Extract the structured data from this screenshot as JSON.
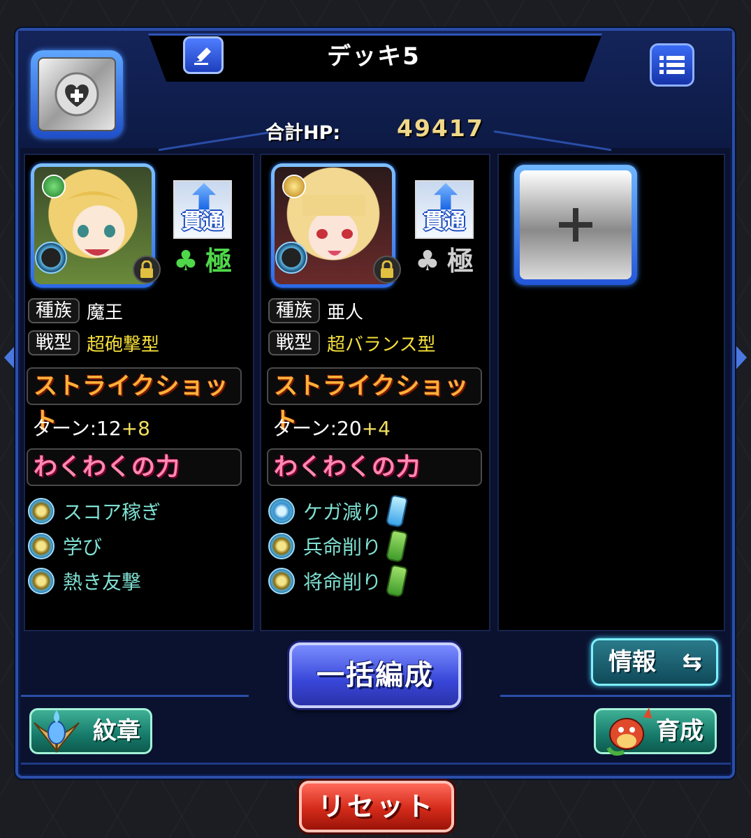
{
  "deck": {
    "title": "デッキ5",
    "hp_label": "合計HP:",
    "hp_value": "49417"
  },
  "characters": [
    {
      "ability": "貫通",
      "rank_label": "極",
      "rank_color": "#4fd84a",
      "element_color": "#3aa84a",
      "species_key": "種族",
      "species": "魔王",
      "type_key": "戦型",
      "type": "超砲撃型",
      "strike_shot_label": "ストライクショット",
      "turn_label": "ターン:12",
      "turn_plus": "+8",
      "waku_label": "わくわくの力",
      "waku_items": [
        {
          "text": "スコア稼ぎ"
        },
        {
          "text": "学び"
        },
        {
          "text": "熱き友撃"
        }
      ]
    },
    {
      "ability": "貫通",
      "rank_label": "極",
      "rank_color": "#d0d0d0",
      "element_color": "#e0b030",
      "species_key": "種族",
      "species": "亜人",
      "type_key": "戦型",
      "type": "超バランス型",
      "strike_shot_label": "ストライクショット",
      "turn_label": "ターン:20",
      "turn_plus": "+4",
      "waku_label": "わくわくの力",
      "waku_items": [
        {
          "text": "ケガ減り"
        },
        {
          "text": "兵命削り"
        },
        {
          "text": "将命削り"
        }
      ]
    }
  ],
  "buttons": {
    "bulk": "一括編成",
    "info": "情報",
    "emblem": "紋章",
    "growth": "育成",
    "reset": "リセット"
  },
  "icons": {
    "edit": "pencil-icon",
    "menu": "list-icon",
    "favorite": "heart-plus-icon",
    "add": "plus-icon",
    "swap": "swap-arrows-icon",
    "lock": "lock-icon"
  }
}
